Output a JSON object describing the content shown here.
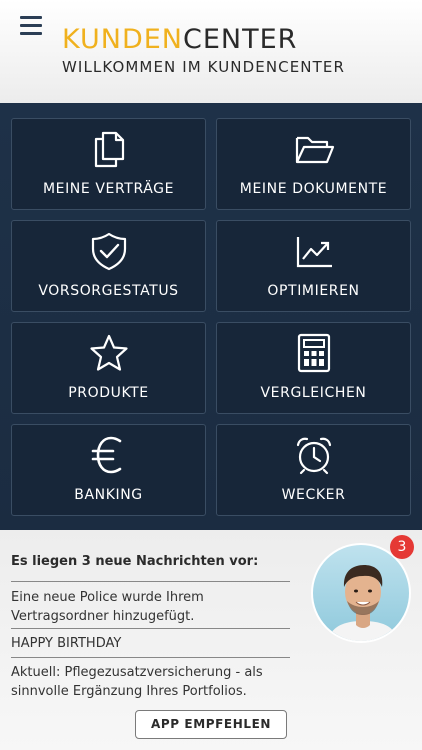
{
  "header": {
    "logo_part1": "KUNDEN",
    "logo_part2": "CENTER",
    "subtitle": "WILLKOMMEN IM KUNDENCENTER",
    "menu_icon": "hamburger-menu-icon"
  },
  "tiles": [
    {
      "label": "MEINE VERTRÄGE",
      "icon": "documents-icon"
    },
    {
      "label": "MEINE DOKUMENTE",
      "icon": "folder-icon"
    },
    {
      "label": "VORSORGESTATUS",
      "icon": "shield-check-icon"
    },
    {
      "label": "OPTIMIEREN",
      "icon": "chart-trend-icon"
    },
    {
      "label": "PRODUKTE",
      "icon": "star-icon"
    },
    {
      "label": "VERGLEICHEN",
      "icon": "calculator-icon"
    },
    {
      "label": "BANKING",
      "icon": "euro-icon"
    },
    {
      "label": "WECKER",
      "icon": "alarm-clock-icon"
    }
  ],
  "messages": {
    "heading": "Es liegen 3 neue Nachrichten vor:",
    "items": [
      "Eine neue Police wurde Ihrem Vertragsordner hinzugefügt.",
      "HAPPY BIRTHDAY",
      "Aktuell: Pflegezusatzversicherung - als sinnvolle Ergänzung Ihres Portfolios."
    ],
    "badge_count": "3",
    "cta_label": "APP EMPFEHLEN"
  },
  "colors": {
    "accent": "#f0b11e",
    "navy": "#1b2c41",
    "badge": "#e53935"
  }
}
